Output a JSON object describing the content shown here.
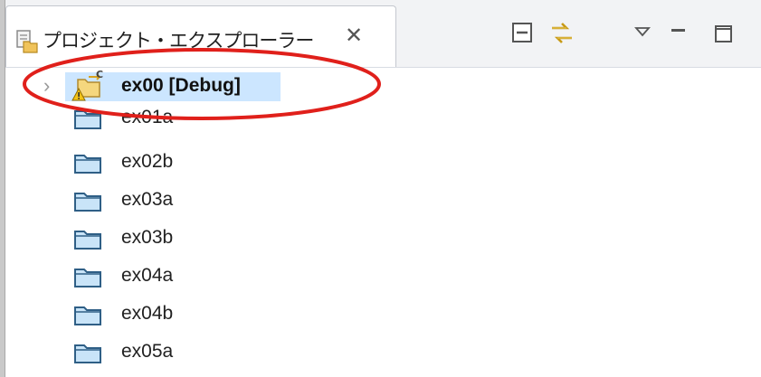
{
  "view": {
    "title": "プロジェクト・エクスプローラー",
    "close_icon": "close-icon",
    "toolbar": [
      {
        "name": "collapse-all-icon"
      },
      {
        "name": "link-with-editor-icon"
      },
      {
        "name": "view-menu-icon"
      },
      {
        "name": "minimize-icon"
      },
      {
        "name": "maximize-icon"
      }
    ]
  },
  "tree": {
    "items": [
      {
        "label": "ex00 [Debug]",
        "icon": "project-warning-icon",
        "expandable": true,
        "selected": true
      },
      {
        "label": "ex01a",
        "icon": "folder-icon"
      },
      {
        "label": "ex02b",
        "icon": "folder-icon"
      },
      {
        "label": "ex03a",
        "icon": "folder-icon"
      },
      {
        "label": "ex03b",
        "icon": "folder-icon"
      },
      {
        "label": "ex04a",
        "icon": "folder-icon"
      },
      {
        "label": "ex04b",
        "icon": "folder-icon"
      },
      {
        "label": "ex05a",
        "icon": "folder-icon"
      }
    ]
  },
  "colors": {
    "selection": "#cce6ff",
    "annotation": "#e0201b",
    "folder_fill": "#c9e4f8",
    "folder_stroke": "#2f5f86"
  }
}
